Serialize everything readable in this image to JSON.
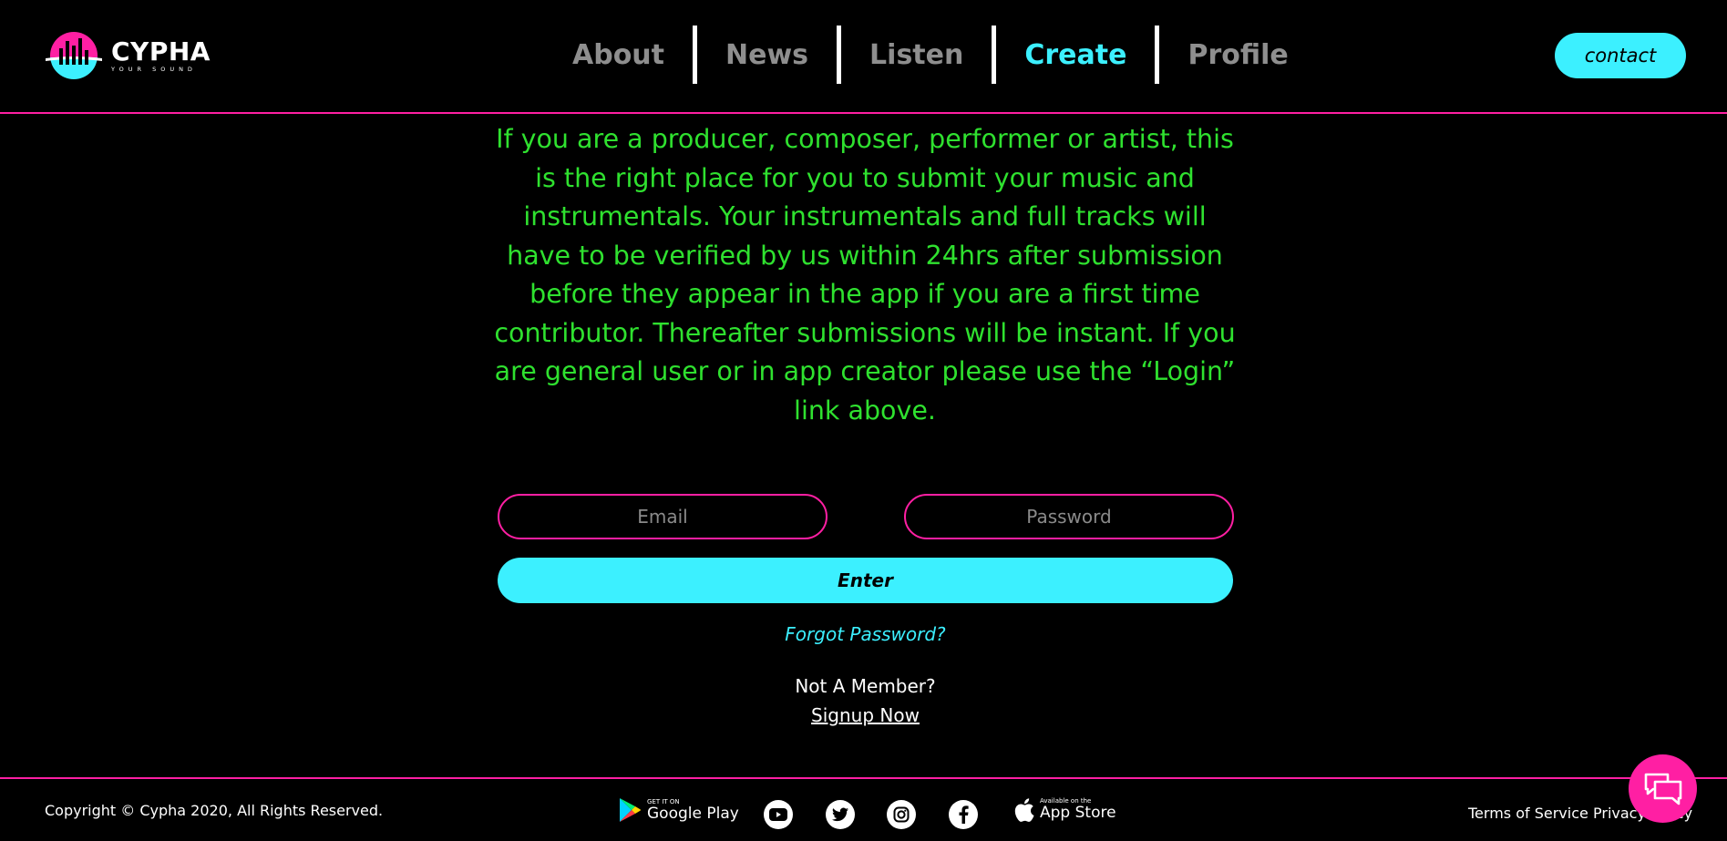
{
  "brand": {
    "name": "CYPHA",
    "tagline": "YOUR SOUND"
  },
  "nav": {
    "items": [
      {
        "label": "About"
      },
      {
        "label": "News"
      },
      {
        "label": "Listen"
      },
      {
        "label": "Create",
        "active": true
      },
      {
        "label": "Profile"
      }
    ],
    "contact_label": "contact"
  },
  "main": {
    "intro": "If you are a producer, composer, performer or artist, this is the right place for you to submit your music and instrumentals. Your instrumentals and full tracks will have to be verified by us within 24hrs after submission before they appear in the app if you are a first time contributor. Thereafter submissions will be instant. If you are general user or in app creator please use the “Login” link above.",
    "email_placeholder": "Email",
    "password_placeholder": "Password",
    "enter_label": "Enter",
    "forgot_label": "Forgot Password?",
    "not_member_label": "Not A Member?",
    "signup_label": "Signup Now"
  },
  "footer": {
    "copyright": "Copyright © Cypha 2020, All Rights Reserved.",
    "google_play": {
      "small": "GET IT ON",
      "big": "Google Play"
    },
    "app_store": {
      "small": "Available on the",
      "big": "App Store"
    },
    "social_icons": [
      "youtube-icon",
      "twitter-icon",
      "instagram-icon",
      "facebook-icon"
    ],
    "terms_label": "Terms of Service",
    "privacy_label": "Privacy Policy"
  },
  "colors": {
    "background": "#000000",
    "accent_pink": "#ff1fa3",
    "accent_cyan": "#3cf0ff",
    "intro_green": "#2fe12f",
    "nav_inactive": "#8e8e8e"
  }
}
